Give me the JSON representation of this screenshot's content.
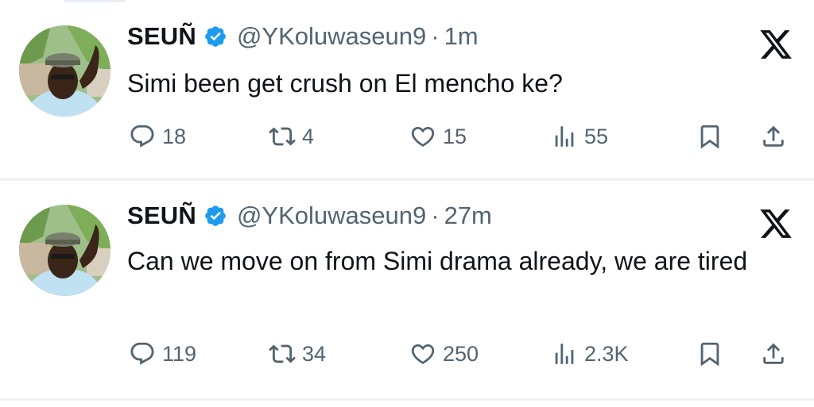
{
  "tweets": [
    {
      "display_name": "SEUÑ",
      "handle": "@YKoluwaseun9",
      "separator": "·",
      "time": "1m",
      "text": "Simi been get crush on El mencho ke?",
      "replies": "18",
      "retweets": "4",
      "likes": "15",
      "views": "55"
    },
    {
      "display_name": "SEUÑ",
      "handle": "@YKoluwaseun9",
      "separator": "·",
      "time": "27m",
      "text": "Can we move on from Simi drama already, we are tired",
      "replies": "119",
      "retweets": "34",
      "likes": "250",
      "views": "2.3K"
    }
  ],
  "colors": {
    "verified": "#1d9bf0",
    "secondary_text": "#536471",
    "primary_text": "#0f1419",
    "divider": "#eff3f4"
  },
  "icons": [
    "verified-badge-icon",
    "x-logo-icon",
    "reply-icon",
    "retweet-icon",
    "like-icon",
    "views-icon",
    "bookmark-icon",
    "share-icon"
  ]
}
